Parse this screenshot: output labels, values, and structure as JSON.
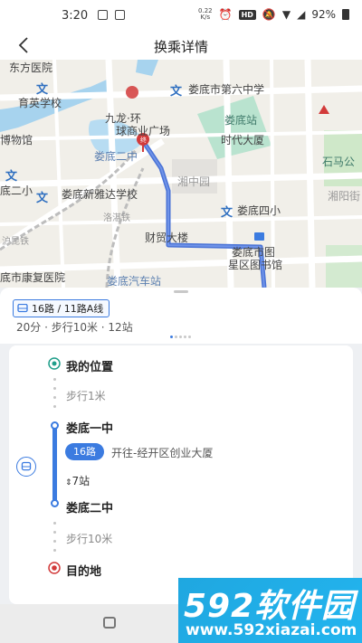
{
  "status_bar": {
    "time": "3:20",
    "net_speed_value": "0.22",
    "net_speed_unit": "K/s",
    "hd_badge": "HD",
    "battery": "92%"
  },
  "header": {
    "title": "换乘详情"
  },
  "map": {
    "labels": [
      "东方医院",
      "育英学校",
      "博物馆",
      "九龙·环",
      "球商业广场",
      "娄底市第六中学",
      "娄底站",
      "时代大厦",
      "石马公",
      "娄底二中",
      "湘中园",
      "底二小",
      "娄底新雅达学校",
      "湘阳街",
      "娄底四小",
      "洛湛铁",
      "沪昆铁",
      "财贸大楼",
      "娄底市图",
      "星区图书馆",
      "底市康复医院",
      "娄底汽车站"
    ],
    "pin_label": "终"
  },
  "sheet": {
    "route_tag": "16路 / 11路A线",
    "summary": "20分 · 步行10米 · 12站"
  },
  "steps": {
    "origin": "我的位置",
    "walk1": "步行1米",
    "board_stop": "娄底一中",
    "line_pill": "16路",
    "line_direction": "开往-经开区创业大厦",
    "stop_count": "7站",
    "alight_stop": "娄底二中",
    "walk2": "步行10米",
    "destination": "目的地"
  },
  "watermark": {
    "brand": "592软件园",
    "url": "www.592xiazai.com"
  },
  "colors": {
    "accent": "#3b7be0",
    "destination": "#d23a3a",
    "origin": "#1f9e8a"
  }
}
